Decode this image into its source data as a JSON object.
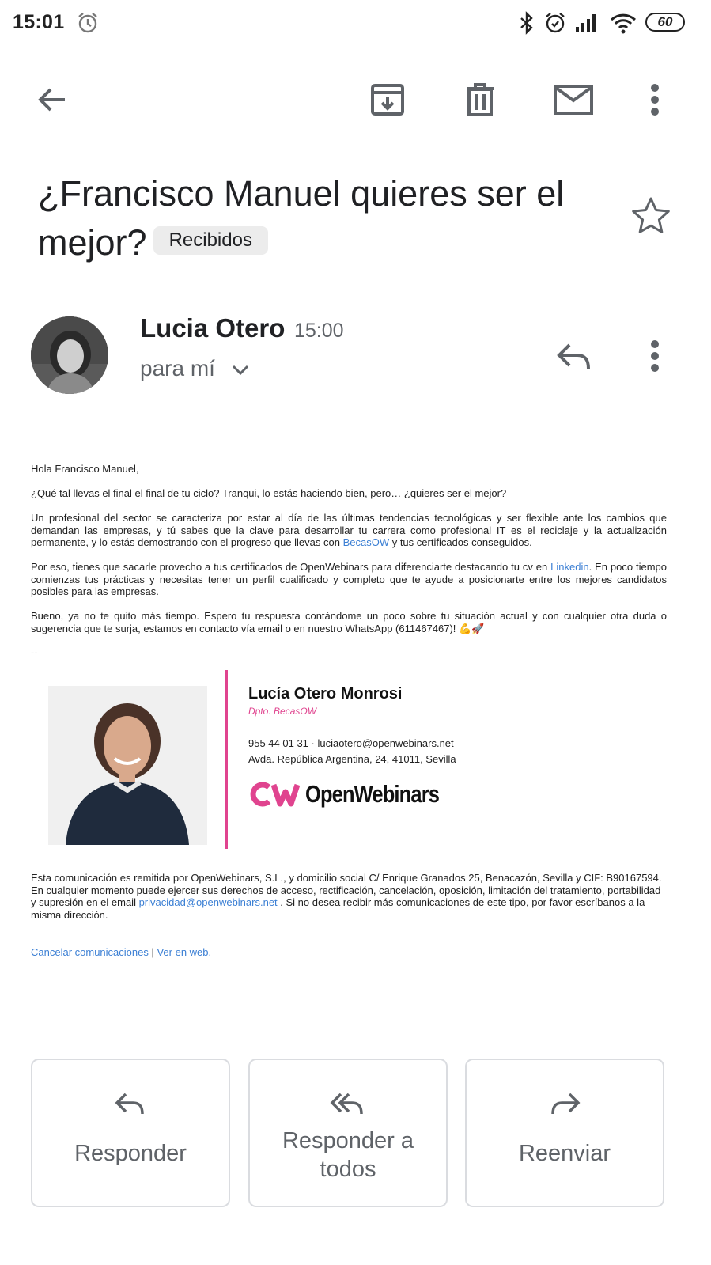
{
  "status_bar": {
    "time": "15:01",
    "battery": "60"
  },
  "email": {
    "subject": "¿Francisco Manuel quieres ser el mejor?",
    "label": "Recibidos",
    "sender": "Lucia Otero",
    "time": "15:00",
    "recipient": "para mí",
    "greeting": "Hola Francisco Manuel,",
    "p1": "¿Qué tal llevas el final el final de tu ciclo? Tranqui, lo estás haciendo bien, pero… ¿quieres ser el mejor?",
    "p2_a": "Un profesional del sector se caracteriza por estar al día de las últimas tendencias tecnológicas y ser flexible ante los cambios que demandan las empresas, y tú sabes que la clave para desarrollar tu carrera como profesional IT es el reciclaje y la actualización permanente, y lo estás demostrando con el progreso que llevas con ",
    "p2_link": "BecasOW",
    "p2_b": " y tus certificados conseguidos.",
    "p3_a": "Por eso, tienes que sacarle provecho a tus certificados de OpenWebinars para diferenciarte destacando tu cv en ",
    "p3_link": "Linkedin",
    "p3_b": ". En poco tiempo comienzas tus prácticas y necesitas tener un perfil cualificado y completo que te ayude a posicionarte entre los mejores candidatos posibles para las empresas.",
    "p4": "Bueno, ya no te quito más tiempo. Espero tu respuesta contándome un poco sobre tu situación actual y con cualquier otra duda o sugerencia que te surja, estamos en contacto vía email o en nuestro WhatsApp (611467467)! 💪🚀",
    "sig_sep": "--",
    "signature": {
      "name": "Lucía Otero Monrosi",
      "dept": "Dpto. BecasOW",
      "contact": "955 44 01 31 · luciaotero@openwebinars.net",
      "address": "Avda. República Argentina, 24, 41011, Sevilla",
      "logo_text": "OpenWebinars"
    },
    "legal_a": "Esta comunicación es remitida por OpenWebinars, S.L., y domicilio social C/ Enrique Granados 25, Benacazón, Sevilla y CIF: B90167594. En cualquier momento puede ejercer sus derechos de acceso, rectificación, cancelación, oposición, limitación del tratamiento, portabilidad y supresión en el email ",
    "legal_link": "privacidad@openwebinars.net",
    "legal_b": " . Si no desea recibir más comunicaciones de este tipo, por favor escríbanos a la misma dirección.",
    "unsubscribe": "Cancelar comunicaciones",
    "sep": " | ",
    "view_web": "Ver en web."
  },
  "actions": {
    "reply": "Responder",
    "reply_all_1": "Responder a",
    "reply_all_2": "todos",
    "forward": "Reenviar"
  },
  "colors": {
    "accent_pink": "#e0448f",
    "link_blue": "#3b7fd4"
  }
}
